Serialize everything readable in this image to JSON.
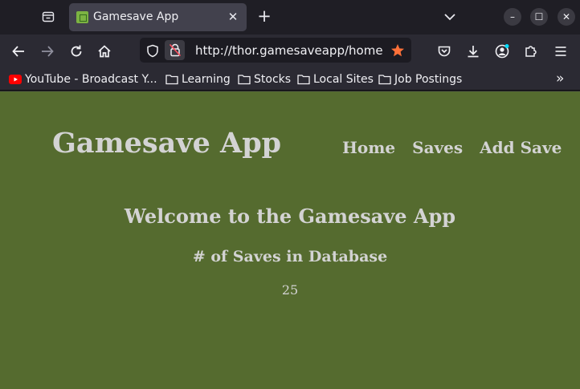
{
  "browser": {
    "tab": {
      "title": "Gamesave App",
      "close_glyph": "✕"
    },
    "new_tab_glyph": "+",
    "window_controls": {
      "minimize": "–",
      "maximize": "☐",
      "close": "✕"
    },
    "url": "http://thor.gamesaveapp/home",
    "bookmarks": [
      "YouTube - Broadcast Y...",
      "Learning",
      "Stocks",
      "Local Sites",
      "Job Postings"
    ],
    "bookmarks_overflow": "»",
    "colors": {
      "favorite_star": "#ff7139",
      "youtube_red": "#ff0000",
      "account_dot": "#00ddff"
    }
  },
  "site": {
    "title": "Gamesave App",
    "nav": [
      "Home",
      "Saves",
      "Add Save"
    ],
    "welcome": "Welcome to the Gamesave App",
    "count_heading": "# of Saves in Database",
    "count_value": "25",
    "colors": {
      "background": "#556b2f",
      "text": "#d3d3d3"
    }
  }
}
